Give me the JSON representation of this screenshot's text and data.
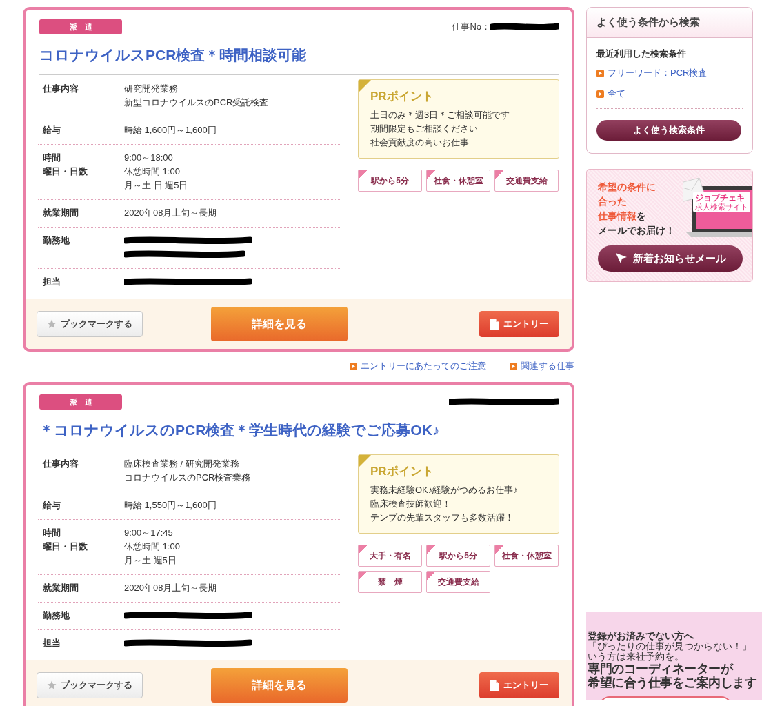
{
  "jobs": [
    {
      "badge": "派　遣",
      "job_no": {
        "label": "仕事No：",
        "redacted": true
      },
      "title": "コロナウイルスPCR検査＊時間相談可能",
      "details": [
        {
          "labels": [
            "仕事内容"
          ],
          "lines": [
            {
              "kind": "text",
              "text": "研究開発業務"
            },
            {
              "kind": "text",
              "text": "新型コロナウイルスのPCR受託検査"
            }
          ]
        },
        {
          "labels": [
            "給与"
          ],
          "lines": [
            {
              "kind": "text",
              "text": "時給 1,600円～1,600円"
            }
          ]
        },
        {
          "labels": [
            "時間",
            "曜日・日数"
          ],
          "lines": [
            {
              "kind": "text",
              "text": "9:00～18:00"
            },
            {
              "kind": "text",
              "text": "休憩時間 1:00"
            },
            {
              "kind": "text",
              "text": "月～土 日 週5日"
            }
          ]
        },
        {
          "labels": [
            "就業期間"
          ],
          "lines": [
            {
              "kind": "text",
              "text": "2020年08月上旬～長期"
            }
          ]
        },
        {
          "labels": [
            "勤務地"
          ],
          "lines": [
            {
              "kind": "redacted"
            },
            {
              "kind": "redacted"
            }
          ]
        },
        {
          "labels": [
            "担当"
          ],
          "lines": [
            {
              "kind": "redacted"
            }
          ]
        }
      ],
      "pr": {
        "heading": "PRポイント",
        "lines": [
          "土日のみ＊週3日＊ご相談可能です",
          "期間限定もご相談ください",
          "社会貢献度の高いお仕事"
        ]
      },
      "tags": [
        "駅から5分",
        "社食・休憩室",
        "交通費支給"
      ],
      "buttons": {
        "bookmark": "ブックマークする",
        "detail": "詳細を見る",
        "entry": "エントリー"
      }
    },
    {
      "badge": "派　遣",
      "job_no": {
        "redacted": true
      },
      "title": "＊コロナウイルスのPCR検査＊学生時代の経験でご応募OK♪",
      "details": [
        {
          "labels": [
            "仕事内容"
          ],
          "lines": [
            {
              "kind": "text",
              "text": "臨床検査業務 / 研究開発業務"
            },
            {
              "kind": "text",
              "text": "コロナウイルスのPCR検査業務"
            }
          ]
        },
        {
          "labels": [
            "給与"
          ],
          "lines": [
            {
              "kind": "text",
              "text": "時給 1,550円～1,600円"
            }
          ]
        },
        {
          "labels": [
            "時間",
            "曜日・日数"
          ],
          "lines": [
            {
              "kind": "text",
              "text": "9:00～17:45"
            },
            {
              "kind": "text",
              "text": "休憩時間 1:00"
            },
            {
              "kind": "text",
              "text": "月～土 週5日"
            }
          ]
        },
        {
          "labels": [
            "就業期間"
          ],
          "lines": [
            {
              "kind": "text",
              "text": "2020年08月上旬～長期"
            }
          ]
        },
        {
          "labels": [
            "勤務地"
          ],
          "lines": [
            {
              "kind": "redacted"
            }
          ]
        },
        {
          "labels": [
            "担当"
          ],
          "lines": [
            {
              "kind": "redacted"
            }
          ]
        }
      ],
      "pr": {
        "heading": "PRポイント",
        "lines": [
          "実務未経験OK♪経験がつめるお仕事♪",
          "臨床検査技師歓迎！",
          "テンプの先輩スタッフも多数活躍！"
        ]
      },
      "tags": [
        "大手・有名",
        "駅から5分",
        "社食・休憩室",
        "禁　煙",
        "交通費支給"
      ],
      "buttons": {
        "bookmark": "ブックマークする",
        "detail": "詳細を見る",
        "entry": "エントリー"
      }
    }
  ],
  "between_links": [
    "エントリーにあたってのご注意",
    "関連する仕事"
  ],
  "sidebar": {
    "saved_search": {
      "title": "よく使う条件から検索",
      "subtitle": "最近利用した検索条件",
      "links": [
        "フリーワード：PCR検査",
        "全て"
      ],
      "button": "よく使う検索条件"
    },
    "mail_promo": {
      "lines": [
        [
          {
            "text": "希望の条件に",
            "highlight": true
          }
        ],
        [
          {
            "text": "合った",
            "highlight": true
          }
        ],
        [
          {
            "text": "仕事情報",
            "highlight": true
          },
          {
            "text": "を",
            "highlight": false
          }
        ],
        [
          {
            "text": "メールでお届け！",
            "highlight": false
          }
        ]
      ],
      "screen_logo": "ジョブチェキ",
      "screen_caption": "求人検索サイト",
      "button": "新着お知らせメール"
    },
    "register_banner": {
      "heading": "登録がお済みでない方へ",
      "lines": [
        "「ぴったりの仕事が見つからない！」",
        "いう方は来社予約を。"
      ],
      "lead": [
        "専門のコーディネーターが",
        "希望に合う仕事をご案内します"
      ]
    }
  }
}
